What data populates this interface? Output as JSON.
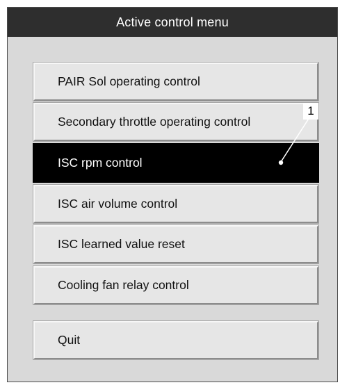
{
  "window": {
    "title": "Active control menu"
  },
  "menu": {
    "items": [
      {
        "label": "PAIR Sol operating control",
        "selected": false
      },
      {
        "label": "Secondary throttle operating control",
        "selected": false
      },
      {
        "label": "ISC rpm control",
        "selected": true
      },
      {
        "label": "ISC air volume control",
        "selected": false
      },
      {
        "label": "ISC learned value reset",
        "selected": false
      },
      {
        "label": "Cooling fan relay control",
        "selected": false
      }
    ],
    "quit_label": "Quit"
  },
  "callout": {
    "label": "1"
  },
  "colors": {
    "titlebar": "#2e2e2e",
    "panel": "#d9d9d9",
    "button": "#e6e6e6",
    "selected": "#000000"
  }
}
